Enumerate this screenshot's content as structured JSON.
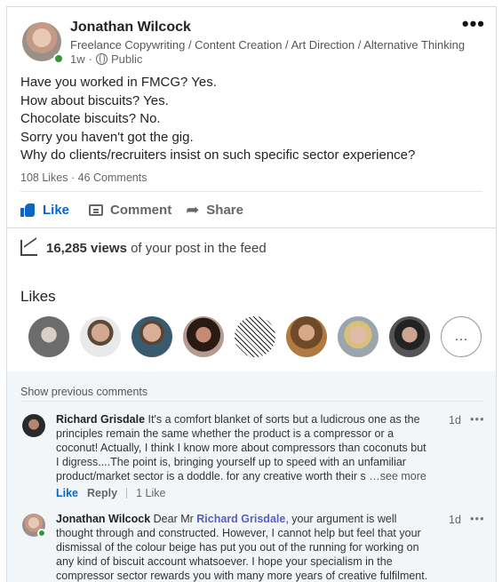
{
  "post": {
    "author": {
      "name": "Jonathan Wilcock",
      "headline": "Freelance Copywriting / Content Creation / Art Direction / Alternative Thinking",
      "time": "1w",
      "visibility": "Public",
      "online": true
    },
    "more_icon": "•••",
    "body_lines": [
      "Have you worked in FMCG? Yes.",
      "How about biscuits? Yes.",
      "Chocolate biscuits? No.",
      "Sorry you haven't got the gig.",
      "Why do clients/recruiters insist on such specific sector experience?"
    ],
    "likes_count": "108 Likes",
    "comments_count": "46 Comments",
    "counts_separator": "·",
    "actions": {
      "like": "Like",
      "comment": "Comment",
      "share": "Share"
    },
    "icons": {
      "like": "thumbs-up-icon",
      "comment": "comment-icon",
      "share": "share-arrow-icon",
      "views": "trending-chart-icon"
    }
  },
  "views": {
    "count": "16,285 views",
    "suffix": " of your post in the feed"
  },
  "likes_section": {
    "title": "Likes",
    "more_label": "…",
    "avatar_colors": [
      "#8a8a8a",
      "#c9a58e",
      "#b89680",
      "#a0705e",
      "#eeeeee",
      "#7a5a40",
      "#c5b6a6",
      "#555555"
    ]
  },
  "comments": {
    "show_previous": "Show previous comments",
    "items": [
      {
        "author": "Richard Grisdale",
        "text": "It's a comfort blanket of sorts but a ludicrous one as the principles remain the same whether the product is a compressor or a coconut! Actually, I think I know more about compressors than coconuts but I digress....The point is, bringing yourself up to speed with an unfamiliar product/market sector is a doddle. for any creative worth their s",
        "see_more": " …see more",
        "time": "1d",
        "more": "•••",
        "like_label": "Like",
        "reply_label": "Reply",
        "like_count": "1 Like"
      },
      {
        "author": "Jonathan Wilcock",
        "pre_mention": "Dear Mr ",
        "mention": "Richard Grisdale",
        "text": ", your argument is well thought through and constructed. However, I cannot help but feel that your dismissal of the colour beige has put you out of the running for working on any kind of biscuit account whatsoever. I hope your specialism in the compressor sector rewards you with many more years of creative fulfilment.",
        "time": "1d",
        "more": "•••",
        "online": true
      }
    ]
  }
}
